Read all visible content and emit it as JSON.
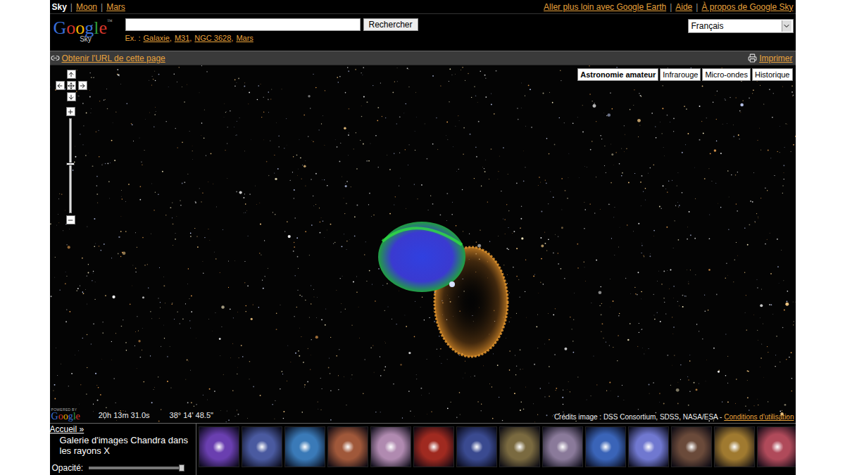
{
  "nav": {
    "items": [
      {
        "label": "Sky",
        "selected": true
      },
      {
        "label": "Moon",
        "selected": false
      },
      {
        "label": "Mars",
        "selected": false
      }
    ],
    "separator": "|"
  },
  "top_links": [
    "Aller plus loin avec Google Earth",
    "Aide",
    "À propos de Google Sky"
  ],
  "logo": {
    "text": "Google",
    "tm": "™",
    "sub": "Sky"
  },
  "search": {
    "value": "",
    "button": "Rechercher",
    "examples_label": "Ex. :",
    "examples": [
      "Galaxie",
      "M31",
      "NGC 3628",
      "Mars"
    ],
    "separator": ","
  },
  "language": {
    "value": "Français"
  },
  "toolbar": {
    "link": "Obtenir l'URL de cette page",
    "print": "Imprimer"
  },
  "layers": [
    {
      "label": "Astronomie amateur",
      "selected": true
    },
    {
      "label": "Infrarouge",
      "selected": false
    },
    {
      "label": "Micro-ondes",
      "selected": false
    },
    {
      "label": "Historique",
      "selected": false
    }
  ],
  "zoom": {
    "level": 0.53
  },
  "map": {
    "powered_by": "POWERED BY",
    "logo": "Google",
    "ra": "20h 13m 31.0s",
    "dec": "38° 14' 48.5\"",
    "credits": "Crédits image : DSS Consortium, SDSS, NASA/ESA -",
    "terms": "Conditions d'utilisation"
  },
  "gallery": {
    "home": "Accueil »",
    "title": "Galerie d'images Chandra dans les rayons X",
    "opacity_label": "Opacité:",
    "opacity": {
      "level": 1
    }
  },
  "thumbnails": [
    {
      "color": "#6a3fb0"
    },
    {
      "color": "#4a5aa0"
    },
    {
      "color": "#3a7ab8"
    },
    {
      "color": "#a0583a"
    },
    {
      "color": "#b08ab0"
    },
    {
      "color": "#a02a20"
    },
    {
      "color": "#3a4a90"
    },
    {
      "color": "#7a6a40"
    },
    {
      "color": "#8a7a9a"
    },
    {
      "color": "#3a64b8"
    },
    {
      "color": "#7078d0"
    },
    {
      "color": "#6a4a3a"
    },
    {
      "color": "#a07a30"
    },
    {
      "color": "#b04a5a"
    }
  ]
}
